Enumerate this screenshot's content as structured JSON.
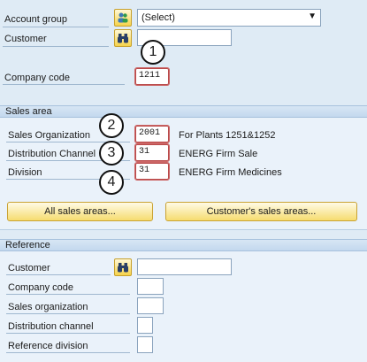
{
  "top": {
    "account_group_label": "Account group",
    "account_group_value": "(Select)",
    "customer_label": "Customer",
    "customer_value": "",
    "company_code_label": "Company code",
    "company_code_value": "1211"
  },
  "sales_area": {
    "header": "Sales area",
    "sales_org_label": "Sales Organization",
    "sales_org_value": "2001",
    "sales_org_desc": "For Plants 1251&1252",
    "dist_channel_label": "Distribution Channel",
    "dist_channel_value": "31",
    "dist_channel_desc": "ENERG Firm Sale",
    "division_label": "Division",
    "division_value": "31",
    "division_desc": "ENERG Firm Medicines",
    "all_sales_areas_button": "All sales areas...",
    "customers_sales_areas_button": "Customer's sales areas..."
  },
  "reference": {
    "header": "Reference",
    "customer_label": "Customer",
    "company_code_label": "Company code",
    "sales_org_label": "Sales organization",
    "dist_channel_label": "Distribution channel",
    "division_label": "Reference division"
  },
  "callouts": [
    "1",
    "2",
    "3",
    "4"
  ],
  "icons": {
    "account_group_icon": "people-icon",
    "customer_search_icon": "binoculars-icon",
    "ref_customer_search_icon": "binoculars-icon"
  }
}
